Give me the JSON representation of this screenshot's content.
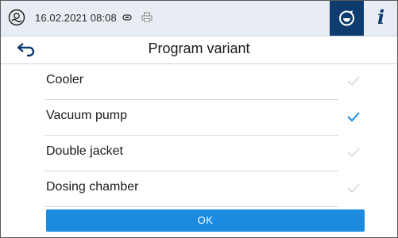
{
  "status": {
    "datetime": "16.02.2021 08:08",
    "device_icon": "device-status-icon",
    "usb_icon": "usb-icon",
    "printer_icon": "printer-icon",
    "service_icon": "service-icon",
    "info_label": "i"
  },
  "header": {
    "back_icon": "back-arrow-icon",
    "title": "Program variant"
  },
  "options": [
    {
      "label": "Cooler",
      "checked": false
    },
    {
      "label": "Vacuum pump",
      "checked": true
    },
    {
      "label": "Double jacket",
      "checked": false
    },
    {
      "label": "Dosing chamber",
      "checked": false
    }
  ],
  "ok_label": "OK",
  "colors": {
    "accent": "#1b8be0",
    "header_dark": "#0f3c6e",
    "status_bg": "#e7edf3",
    "check_active": "#1b8be0",
    "check_inactive": "#d3d8dc"
  }
}
